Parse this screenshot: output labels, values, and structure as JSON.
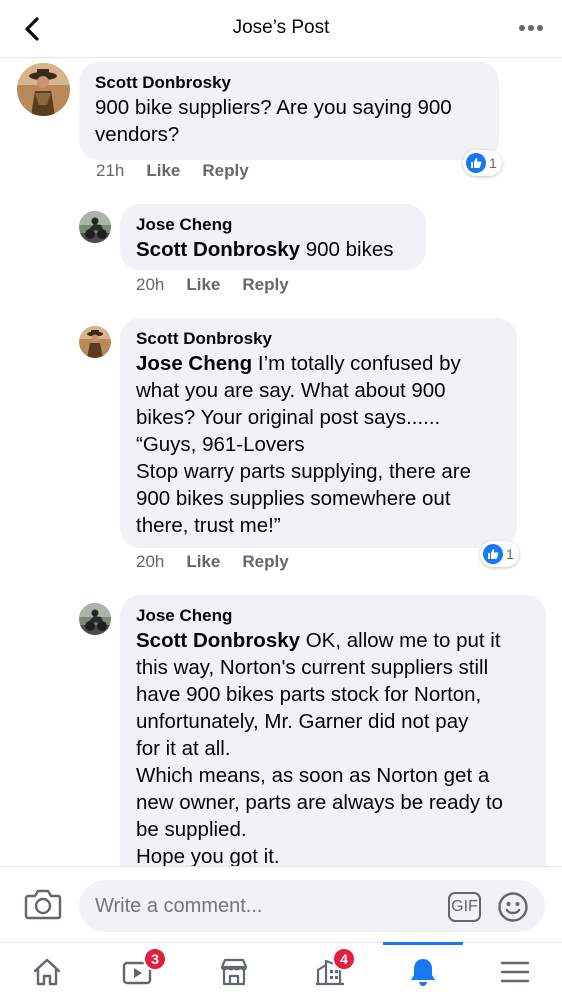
{
  "header": {
    "title": "Jose’s Post",
    "back_icon": "chevron-left-icon",
    "more_icon": "more-dots-icon"
  },
  "comments": [
    {
      "author": "Scott Donbrosky",
      "mention": "",
      "text": "900 bike suppliers? Are you saying 900\nvendors?",
      "time": "21h",
      "like_label": "Like",
      "reply_label": "Reply",
      "reaction_count": "1"
    },
    {
      "author": "Jose  Cheng",
      "mention": "Scott Donbrosky",
      "text": " 900 bikes",
      "time": "20h",
      "like_label": "Like",
      "reply_label": "Reply"
    },
    {
      "author": "Scott Donbrosky",
      "mention": "Jose  Cheng",
      "text": " I’m totally confused by\nwhat you are say. What about 900\nbikes? Your original post says......\n“Guys, 961-Lovers\nStop warry parts supplying, there are\n900 bikes supplies somewhere out\nthere, trust me!”",
      "time": "20h",
      "like_label": "Like",
      "reply_label": "Reply",
      "reaction_count": "1"
    },
    {
      "author": "Jose  Cheng",
      "mention": "Scott Donbrosky",
      "text": " OK, allow me to put it\nthis way, Norton's current suppliers still\nhave 900 bikes parts stock for Norton,\nunfortunately, Mr. Garner did not pay\nfor it at all.\nWhich means, as soon as Norton get a\nnew owner, parts are always be ready to\nbe supplied.\nHope you got it."
    }
  ],
  "composer": {
    "placeholder": "Write a comment...",
    "gif_label": "GIF",
    "camera_icon": "camera-icon",
    "emoji_icon": "emoji-icon"
  },
  "tabbar": {
    "tabs": [
      {
        "icon": "home-icon",
        "badge": ""
      },
      {
        "icon": "watch-video-icon",
        "badge": "3"
      },
      {
        "icon": "marketplace-icon",
        "badge": ""
      },
      {
        "icon": "pages-icon",
        "badge": "4"
      },
      {
        "icon": "notifications-bell-icon",
        "badge": "",
        "active": true
      },
      {
        "icon": "menu-icon",
        "badge": ""
      }
    ]
  },
  "colors": {
    "accent": "#1877f2",
    "bubble": "#f0f2f5",
    "badge": "#e41e3f",
    "meta_text": "#65676b"
  }
}
